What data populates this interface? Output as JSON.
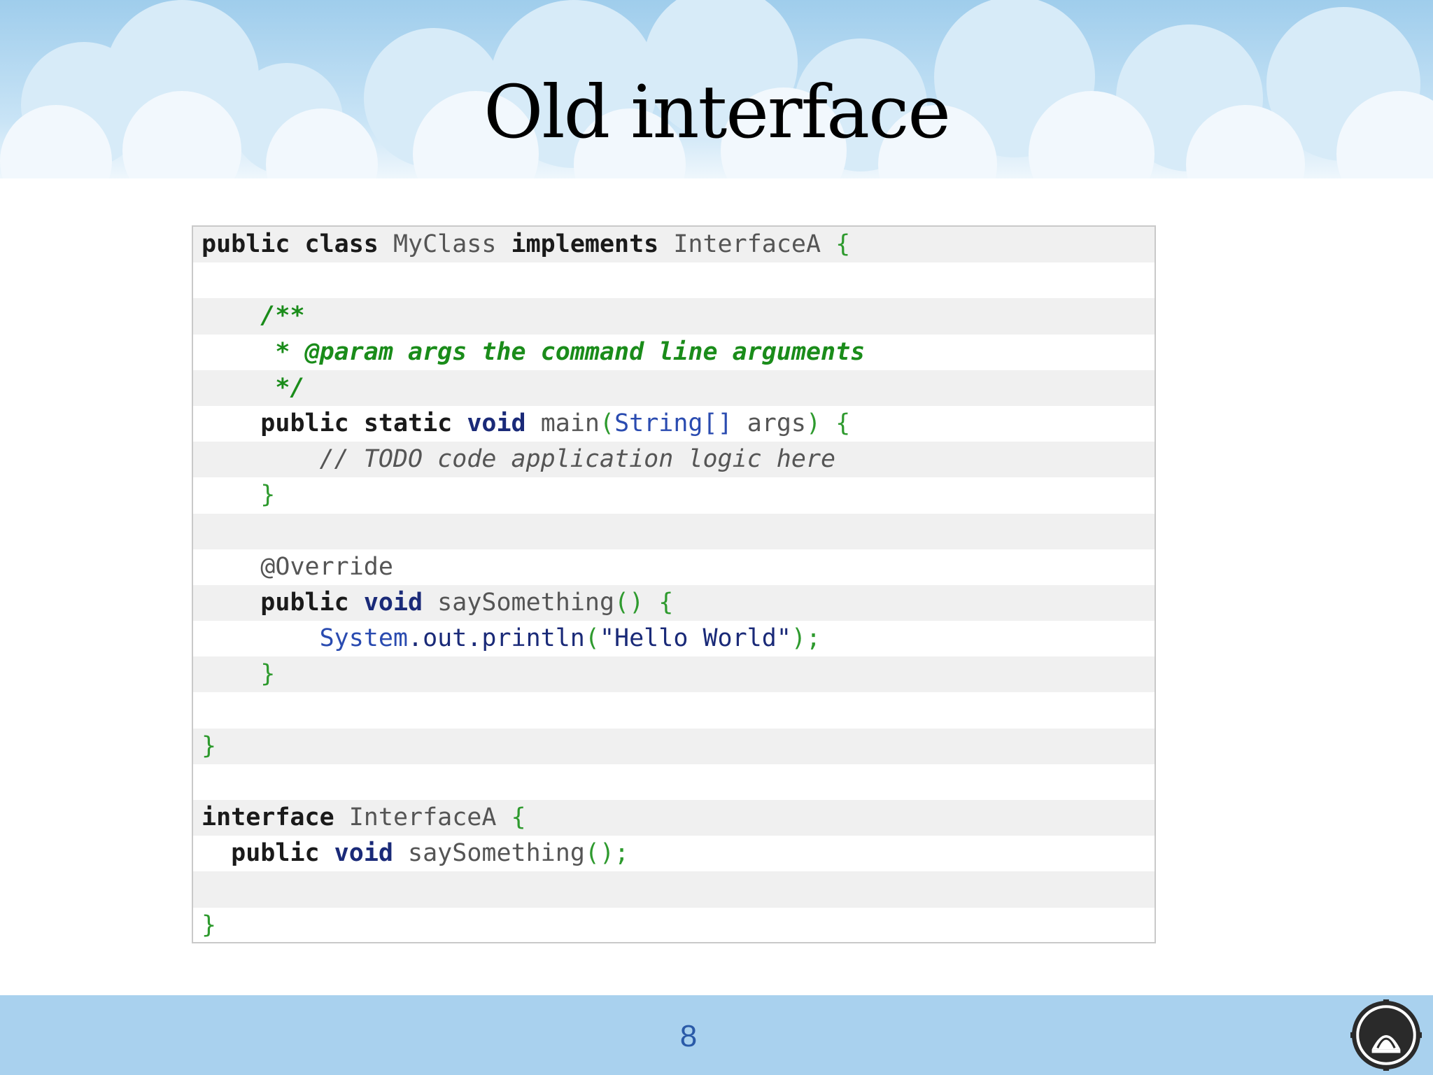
{
  "slide": {
    "title": "Old interface",
    "page_number": "8"
  },
  "code": {
    "lines": [
      [
        {
          "t": "public",
          "c": "kw"
        },
        {
          "t": " "
        },
        {
          "t": "class",
          "c": "kw"
        },
        {
          "t": " MyClass ",
          "c": "ty"
        },
        {
          "t": "implements",
          "c": "kw"
        },
        {
          "t": " InterfaceA ",
          "c": "ty"
        },
        {
          "t": "{",
          "c": "br"
        }
      ],
      [],
      [
        {
          "t": "    "
        },
        {
          "t": "/**",
          "c": "cm"
        }
      ],
      [
        {
          "t": "     "
        },
        {
          "t": "* @param args the command line arguments",
          "c": "cm"
        }
      ],
      [
        {
          "t": "     "
        },
        {
          "t": "*/",
          "c": "cm"
        }
      ],
      [
        {
          "t": "    "
        },
        {
          "t": "public",
          "c": "kw"
        },
        {
          "t": " "
        },
        {
          "t": "static",
          "c": "kw"
        },
        {
          "t": " "
        },
        {
          "t": "void",
          "c": "kw2"
        },
        {
          "t": " main",
          "c": "ty"
        },
        {
          "t": "(",
          "c": "br"
        },
        {
          "t": "String[]",
          "c": "cls"
        },
        {
          "t": " args",
          "c": "ty"
        },
        {
          "t": ")",
          "c": "br"
        },
        {
          "t": " "
        },
        {
          "t": "{",
          "c": "br"
        }
      ],
      [
        {
          "t": "        "
        },
        {
          "t": "// TODO code application logic here",
          "c": "cm2"
        }
      ],
      [
        {
          "t": "    "
        },
        {
          "t": "}",
          "c": "br"
        }
      ],
      [],
      [
        {
          "t": "    "
        },
        {
          "t": "@Override",
          "c": "ty"
        }
      ],
      [
        {
          "t": "    "
        },
        {
          "t": "public",
          "c": "kw"
        },
        {
          "t": " "
        },
        {
          "t": "void",
          "c": "kw2"
        },
        {
          "t": " saySomething",
          "c": "ty"
        },
        {
          "t": "()",
          "c": "br"
        },
        {
          "t": " "
        },
        {
          "t": "{",
          "c": "br"
        }
      ],
      [
        {
          "t": "        "
        },
        {
          "t": "System",
          "c": "cls"
        },
        {
          "t": ".out.println",
          "c": "str"
        },
        {
          "t": "(",
          "c": "br"
        },
        {
          "t": "\"Hello World\"",
          "c": "str"
        },
        {
          "t": ");",
          "c": "br"
        }
      ],
      [
        {
          "t": "    "
        },
        {
          "t": "}",
          "c": "br"
        }
      ],
      [],
      [
        {
          "t": "}",
          "c": "br"
        }
      ],
      [],
      [
        {
          "t": "interface",
          "c": "kw"
        },
        {
          "t": " InterfaceA ",
          "c": "ty"
        },
        {
          "t": "{",
          "c": "br"
        }
      ],
      [
        {
          "t": "  "
        },
        {
          "t": "public",
          "c": "kw"
        },
        {
          "t": " "
        },
        {
          "t": "void",
          "c": "kw2"
        },
        {
          "t": " saySomething",
          "c": "ty"
        },
        {
          "t": "();",
          "c": "br"
        }
      ],
      [],
      [
        {
          "t": "}",
          "c": "br"
        }
      ]
    ]
  },
  "colors": {
    "sky": "#a8d4ef",
    "footer": "#a9d1ee",
    "page_number": "#2a5aa8"
  },
  "icons": {
    "logo": "university-seal-icon"
  }
}
